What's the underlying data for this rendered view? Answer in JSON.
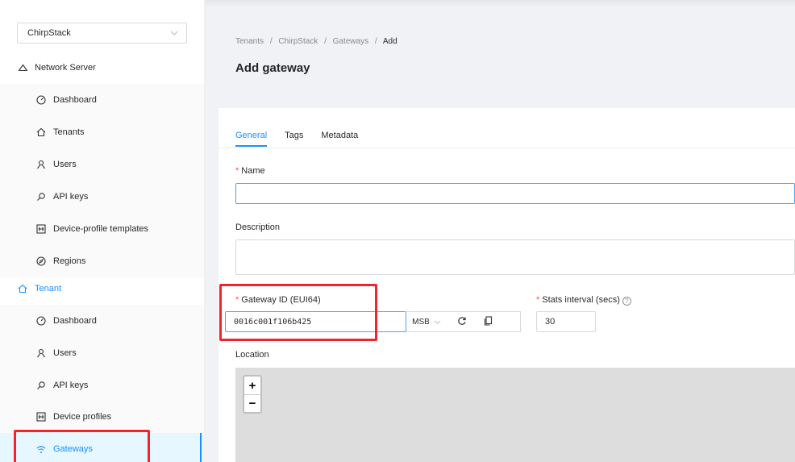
{
  "sidebar": {
    "tenant_select": "ChirpStack",
    "network_server": {
      "label": "Network Server",
      "items": [
        {
          "label": "Dashboard",
          "icon": "dashboard-icon"
        },
        {
          "label": "Tenants",
          "icon": "home-icon"
        },
        {
          "label": "Users",
          "icon": "user-icon"
        },
        {
          "label": "API keys",
          "icon": "key-icon"
        },
        {
          "label": "Device-profile templates",
          "icon": "template-icon"
        },
        {
          "label": "Regions",
          "icon": "compass-icon"
        }
      ]
    },
    "tenant": {
      "label": "Tenant",
      "items": [
        {
          "label": "Dashboard",
          "icon": "dashboard-icon"
        },
        {
          "label": "Users",
          "icon": "user-icon"
        },
        {
          "label": "API keys",
          "icon": "key-icon"
        },
        {
          "label": "Device profiles",
          "icon": "template-icon"
        },
        {
          "label": "Gateways",
          "icon": "wifi-icon",
          "selected": true
        }
      ]
    }
  },
  "breadcrumb": {
    "items": [
      "Tenants",
      "ChirpStack",
      "Gateways"
    ],
    "current": "Add",
    "separator": "/"
  },
  "page": {
    "title": "Add gateway"
  },
  "tabs": [
    {
      "label": "General",
      "active": true
    },
    {
      "label": "Tags",
      "active": false
    },
    {
      "label": "Metadata",
      "active": false
    }
  ],
  "form": {
    "name_label": "Name",
    "name_value": "",
    "description_label": "Description",
    "description_value": "",
    "gateway_id_label": "Gateway ID (EUI64)",
    "gateway_id_value": "0016c001f106b425",
    "byte_order": "MSB",
    "stats_interval_label": "Stats interval (secs)",
    "stats_interval_value": "30",
    "location_label": "Location",
    "required_mark": "*"
  },
  "map": {
    "zoom_in": "+",
    "zoom_out": "−"
  },
  "colors": {
    "primary": "#1890ff",
    "highlight": "#f5222d",
    "required": "#ff4d4f"
  }
}
